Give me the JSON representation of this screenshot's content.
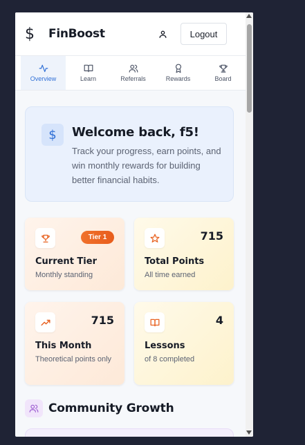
{
  "header": {
    "brand": "FinBoost",
    "logout_label": "Logout"
  },
  "tabs": [
    {
      "label": "Overview",
      "icon": "activity-icon",
      "active": true
    },
    {
      "label": "Learn",
      "icon": "book-open-icon"
    },
    {
      "label": "Referrals",
      "icon": "users-icon"
    },
    {
      "label": "Rewards",
      "icon": "award-icon"
    },
    {
      "label": "Board",
      "icon": "trophy-icon"
    }
  ],
  "welcome": {
    "title": "Welcome back, f5!",
    "text": "Track your progress, earn points, and win monthly rewards for building better financial habits."
  },
  "stats": [
    {
      "title": "Current Tier",
      "subtitle": "Monthly standing",
      "badge": "Tier 1",
      "icon": "trophy-icon"
    },
    {
      "title": "Total Points",
      "subtitle": "All time earned",
      "value": "715",
      "icon": "star-icon"
    },
    {
      "title": "This Month",
      "subtitle": "Theoretical points only",
      "value": "715",
      "icon": "trending-up-icon"
    },
    {
      "title": "Lessons",
      "subtitle": "of 8 completed",
      "value": "4",
      "icon": "book-open-icon"
    }
  ],
  "section": {
    "title": "Community Growth",
    "icon": "users-icon"
  },
  "colors": {
    "accent_blue": "#2f6fd6",
    "accent_orange": "#e8611f",
    "accent_purple": "#9b59d0",
    "background": "#1f2335"
  }
}
